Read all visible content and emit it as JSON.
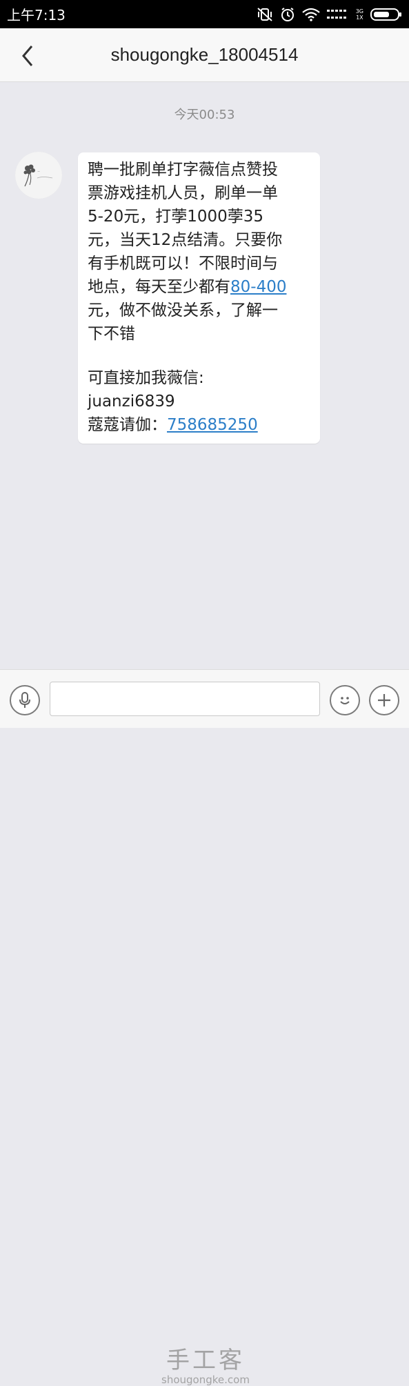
{
  "status_bar": {
    "time": "上午7:13",
    "network_top": "3G",
    "network_bottom": "1X"
  },
  "header": {
    "title": "shougongke_18004514"
  },
  "conversation": {
    "timestamp": "今天00:53",
    "message": {
      "line1": "聘一批刷单打字薇信点赞投",
      "line2": "票游戏挂机人员，刷单一单",
      "line3": "5-20元，打荸1000荸35",
      "line4": "元，当天12点结清。只要你",
      "line5": "有手机既可以！不限时间与",
      "line6_prefix": "地点，每天至少都有",
      "line6_link": "80-400",
      "line7": "元，做不做没关系，了解一",
      "line8": "下不错",
      "contact_label": "可直接加我薇信:",
      "contact_id": "juanzi6839",
      "qq_label": "蔻蔻请伽：",
      "qq_link": "758685250"
    }
  },
  "input_bar": {
    "placeholder": ""
  },
  "watermark": {
    "cn": "手工客",
    "en": "shougongke.com"
  }
}
